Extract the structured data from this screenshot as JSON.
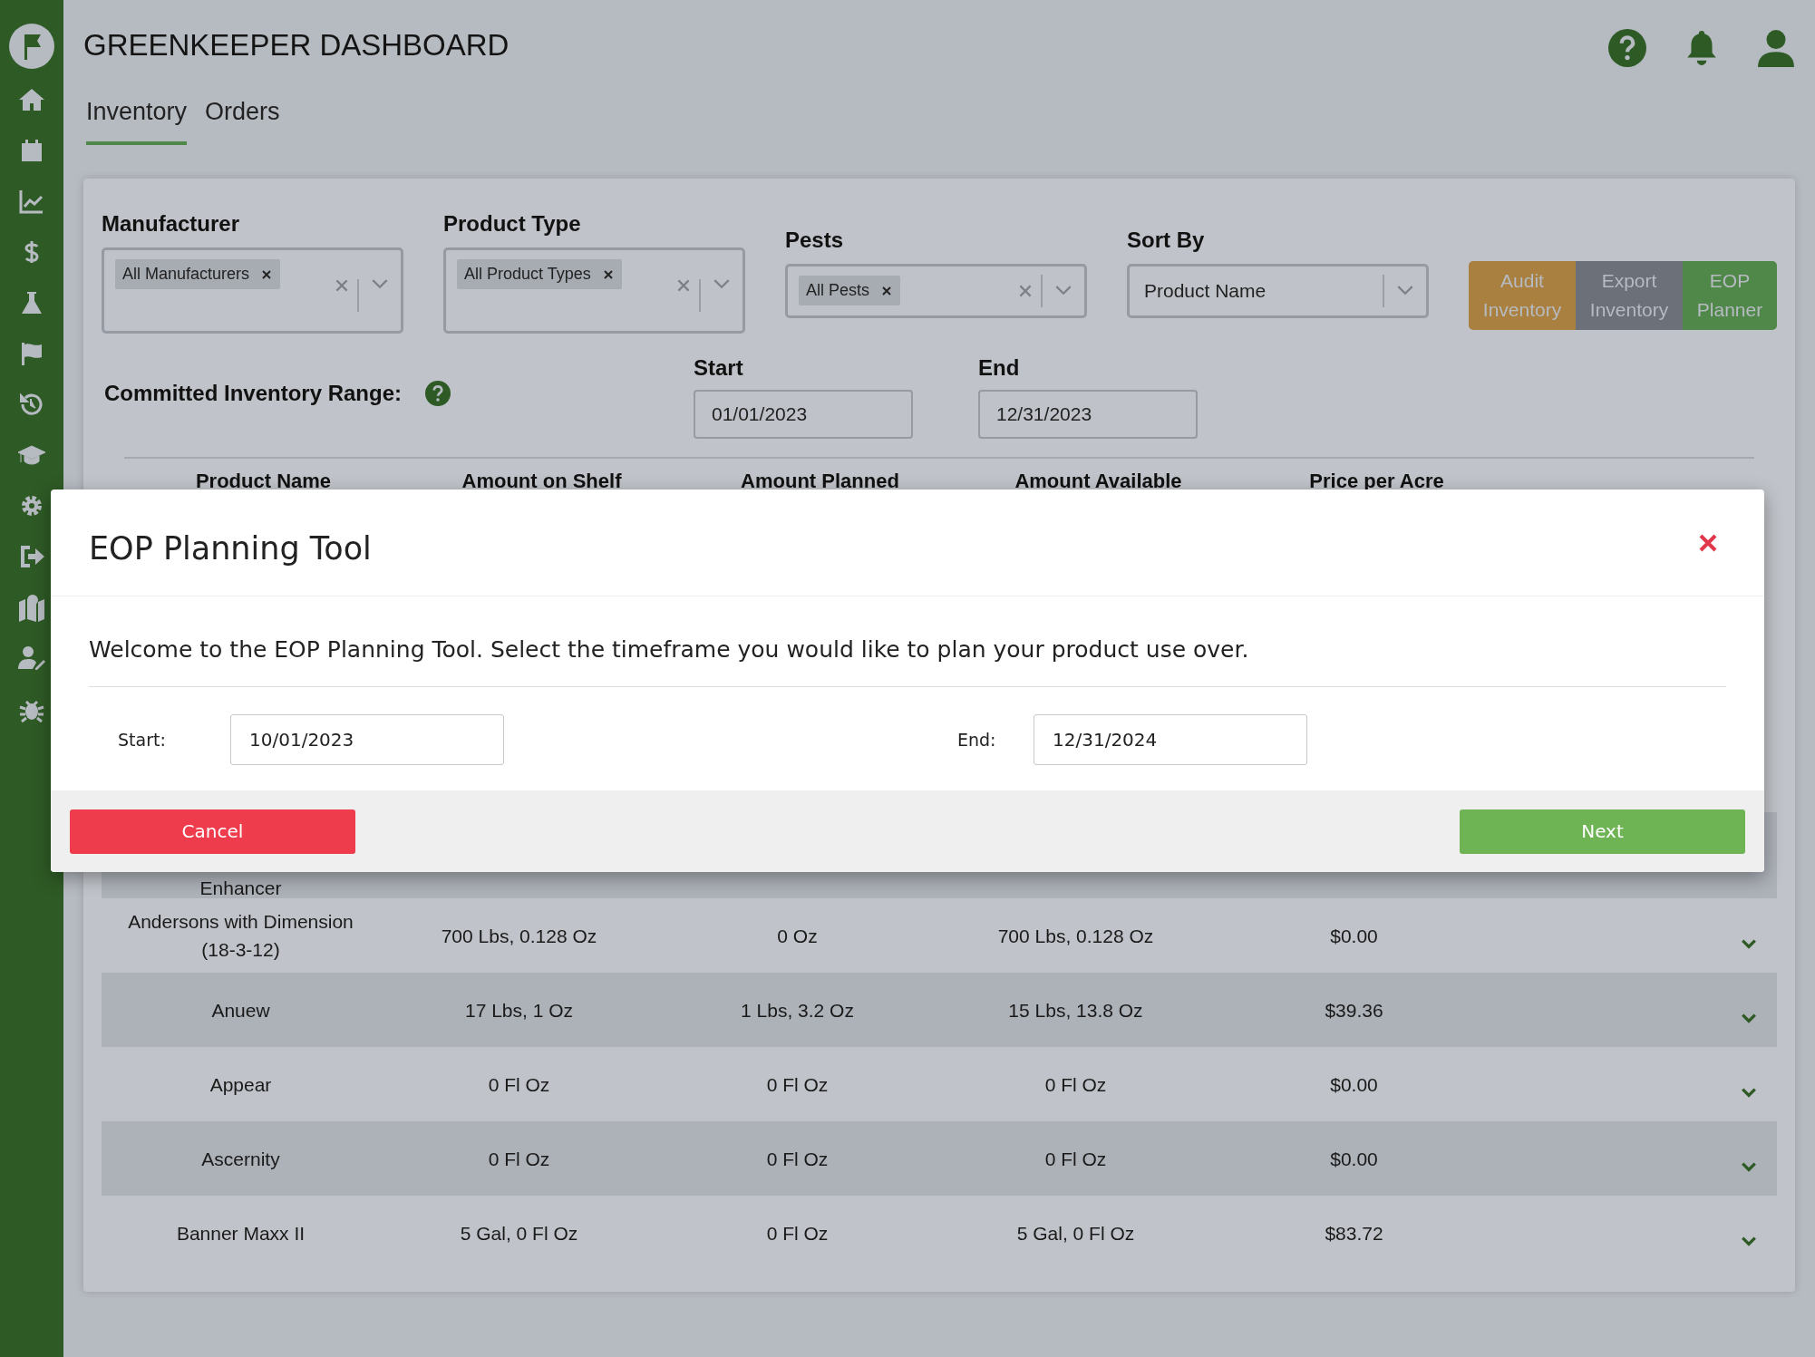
{
  "app": {
    "title": "GREENKEEPER DASHBOARD"
  },
  "tabs": [
    {
      "label": "Inventory",
      "selected": true
    },
    {
      "label": "Orders",
      "selected": false
    }
  ],
  "filters": [
    {
      "label": "Manufacturer",
      "kind": "multi",
      "chips": [
        "All Manufacturers"
      ]
    },
    {
      "label": "Product Type",
      "kind": "multi",
      "chips": [
        "All Product Types"
      ]
    },
    {
      "label": "Pests",
      "kind": "multi-short",
      "chips": [
        "All Pests"
      ]
    },
    {
      "label": "Sort By",
      "kind": "single",
      "value": "Product Name"
    }
  ],
  "actions": [
    {
      "label": "Audit Inventory",
      "color": "#a9803f"
    },
    {
      "label": "Export Inventory",
      "color": "#6c7079"
    },
    {
      "label": "EOP Planner",
      "color": "#50884a"
    }
  ],
  "committed_range": {
    "label": "Committed Inventory Range:",
    "start_label": "Start",
    "start": "01/01/2023",
    "end_label": "End",
    "end": "12/31/2023"
  },
  "table": {
    "columns": [
      "Product Name",
      "Amount on Shelf",
      "Amount Planned",
      "Amount Available",
      "Price per Acre"
    ],
    "rows": [
      {
        "cells": [
          "Enhancer"
        ]
      },
      {
        "cells": [
          "Andersons with Dimension (18-3-12)",
          "700 Lbs, 0.128 Oz",
          "0 Oz",
          "700 Lbs, 0.128 Oz",
          "$0.00"
        ]
      },
      {
        "cells": [
          "Anuew",
          "17 Lbs, 1 Oz",
          "1 Lbs, 3.2 Oz",
          "15 Lbs, 13.8 Oz",
          "$39.36"
        ]
      },
      {
        "cells": [
          "Appear",
          "0 Fl Oz",
          "0 Fl Oz",
          "0 Fl Oz",
          "$0.00"
        ]
      },
      {
        "cells": [
          "Ascernity",
          "0 Fl Oz",
          "0 Fl Oz",
          "0 Fl Oz",
          "$0.00"
        ]
      },
      {
        "cells": [
          "Banner Maxx II",
          "5 Gal, 0 Fl Oz",
          "0 Fl Oz",
          "5 Gal, 0 Fl Oz",
          "$83.72"
        ]
      }
    ]
  },
  "modal": {
    "title": "EOP Planning Tool",
    "message": "Welcome to the EOP Planning Tool. Select the timeframe you would like to plan your product use over.",
    "start_label": "Start:",
    "start": "10/01/2023",
    "end_label": "End:",
    "end": "12/31/2024",
    "buttons": [
      {
        "label": "Cancel",
        "kind": "cancel"
      },
      {
        "label": "Next",
        "kind": "primary"
      }
    ]
  }
}
